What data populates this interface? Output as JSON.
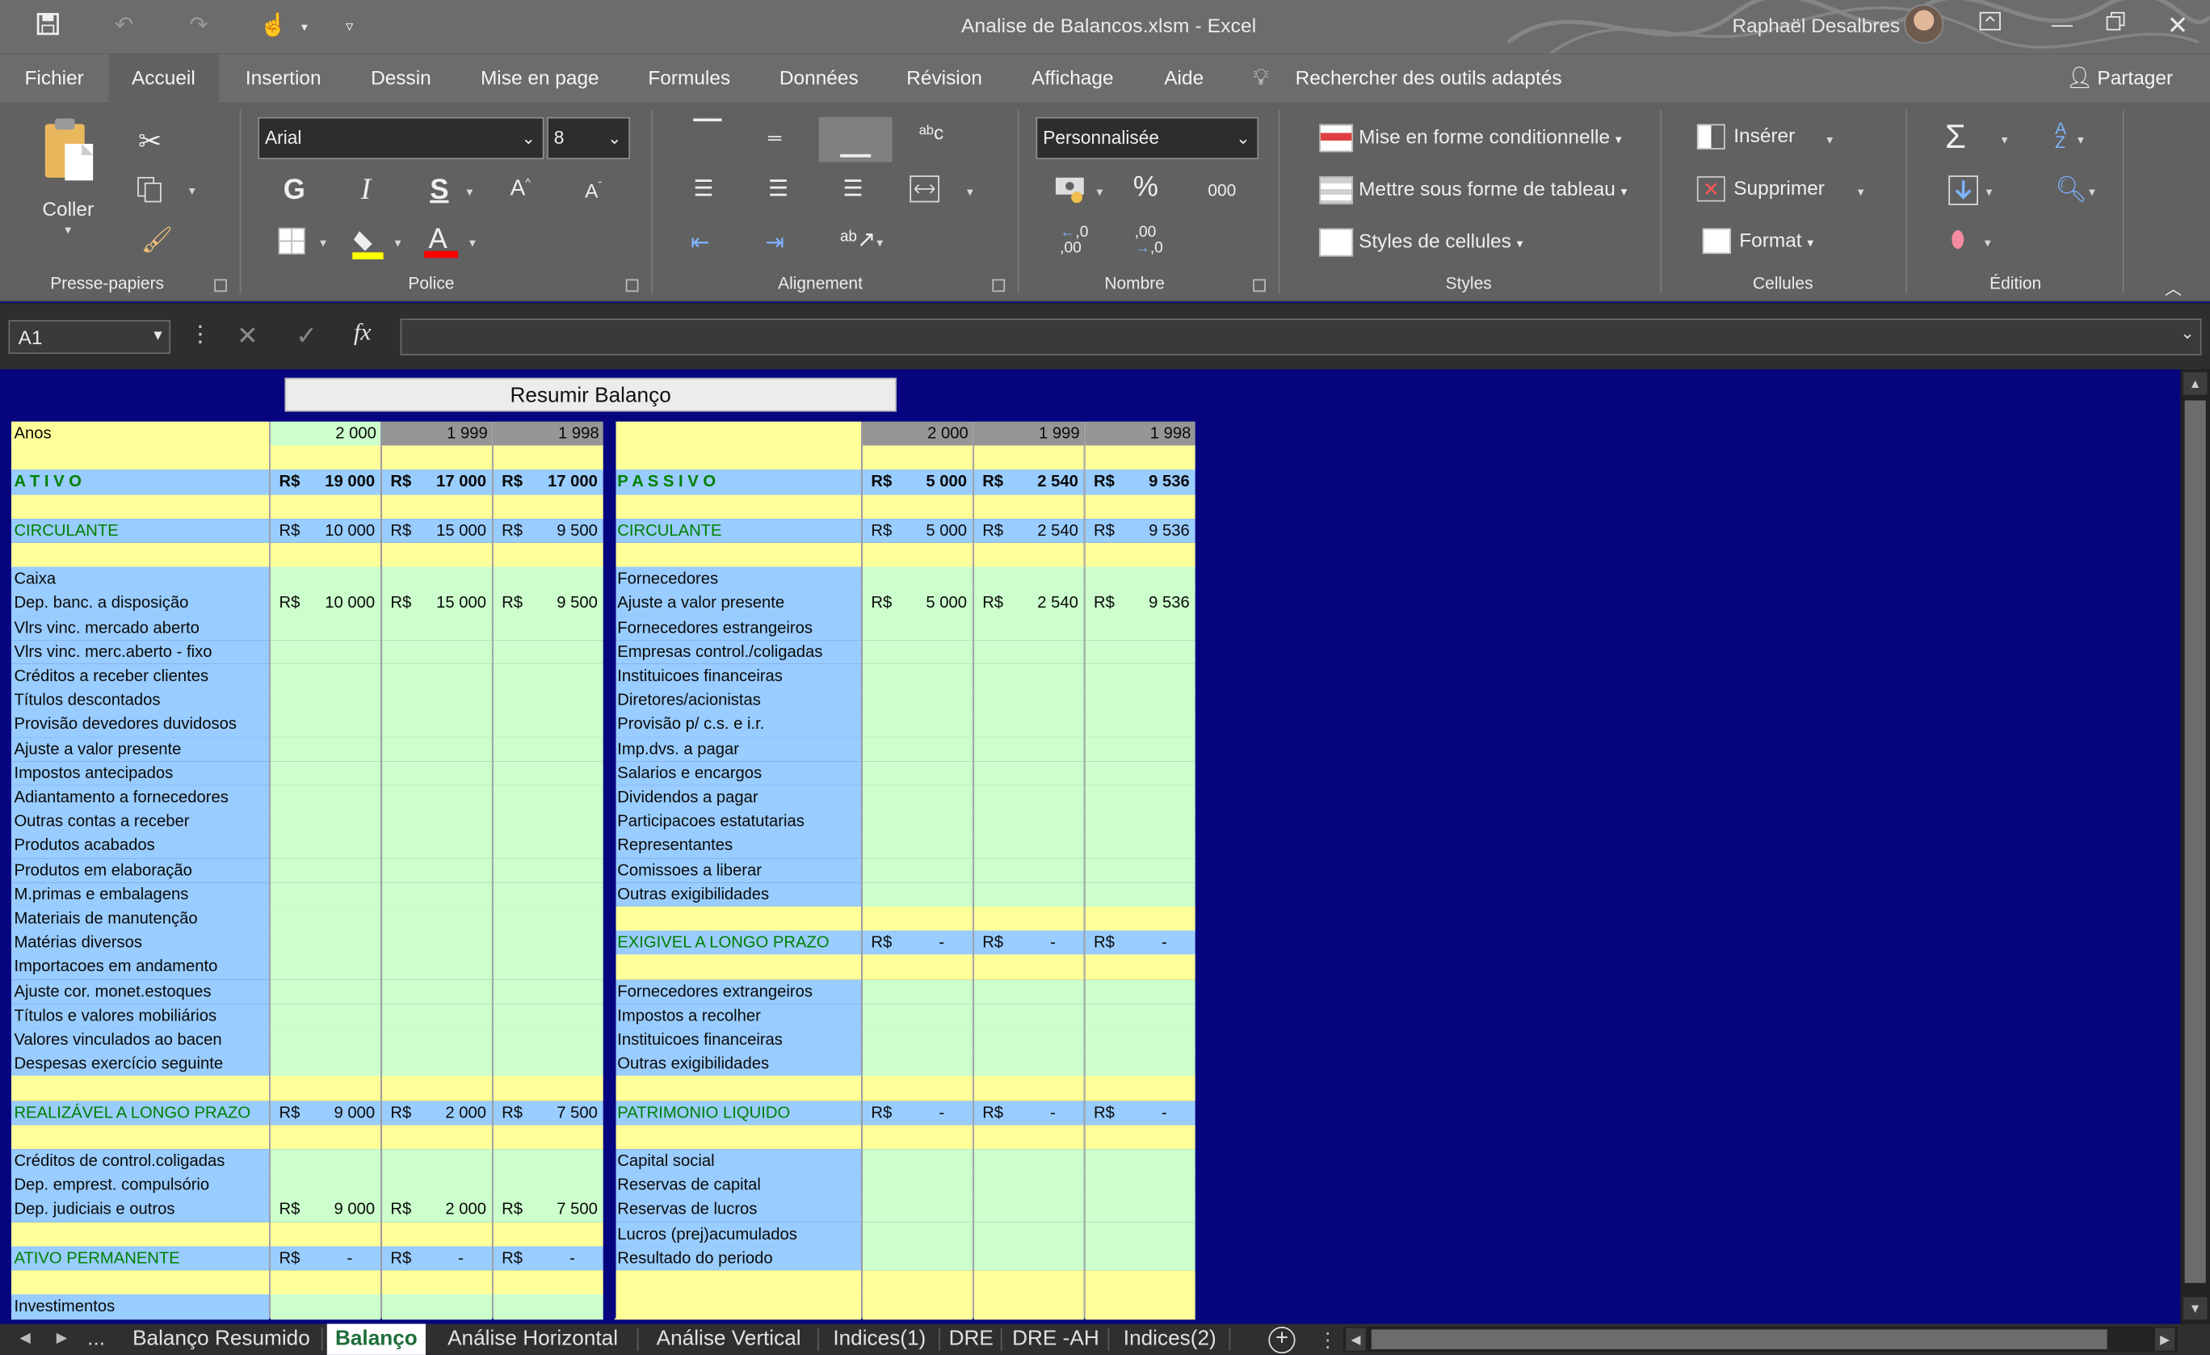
{
  "window": {
    "title": "Analise de Balancos.xlsm  -  Excel",
    "user": "Raphaël Desalbres"
  },
  "tabs": [
    "Fichier",
    "Accueil",
    "Insertion",
    "Dessin",
    "Mise en page",
    "Formules",
    "Données",
    "Révision",
    "Affichage",
    "Aide"
  ],
  "tellme": "Rechercher des outils adaptés",
  "share": "Partager",
  "ribbon": {
    "paste": "Coller",
    "groups": {
      "clipboard": "Presse-papiers",
      "font": "Police",
      "alignment": "Alignement",
      "number": "Nombre",
      "styles": "Styles",
      "cells": "Cellules",
      "editing": "Édition"
    },
    "font_name": "Arial",
    "font_size": "8",
    "number_format": "Personnalisée",
    "styles_buttons": [
      "Mise en forme conditionnelle",
      "Mettre sous forme de tableau",
      "Styles de cellules"
    ],
    "cells_buttons": [
      "Insérer",
      "Supprimer",
      "Format"
    ],
    "bold": "G",
    "italic": "I",
    "underline": "S",
    "percent": "%",
    "thousands": "000"
  },
  "formula_bar": {
    "name_box": "A1",
    "fx": "fx",
    "value": ""
  },
  "sheet": {
    "button": "Resumir Balanço",
    "years": [
      "2 000",
      "1 999",
      "1 998"
    ],
    "currency": "R$",
    "left_header": "Anos",
    "left": [
      {
        "label": "A T I V O",
        "style": "section",
        "values": [
          "19 000",
          "17 000",
          "17 000"
        ]
      },
      {
        "label": "CIRCULANTE",
        "style": "group",
        "values": [
          "10 000",
          "15 000",
          "9 500"
        ]
      },
      {
        "label": "Caixa"
      },
      {
        "label": "Dep. banc. a disposição",
        "values": [
          "10 000",
          "15 000",
          "9 500"
        ]
      },
      {
        "label": "Vlrs vinc. mercado aberto"
      },
      {
        "label": "Vlrs vinc. merc.aberto - fixo"
      },
      {
        "label": "Créditos a receber clientes"
      },
      {
        "label": "Títulos descontados"
      },
      {
        "label": "Provisão devedores duvidosos"
      },
      {
        "label": "Ajuste a valor presente"
      },
      {
        "label": "Impostos antecipados"
      },
      {
        "label": "Adiantamento a fornecedores"
      },
      {
        "label": "Outras contas a receber"
      },
      {
        "label": "Produtos acabados"
      },
      {
        "label": "Produtos em elaboração"
      },
      {
        "label": "M.primas e embalagens"
      },
      {
        "label": "Materiais de manutenção"
      },
      {
        "label": "Matérias diversos"
      },
      {
        "label": "Importacoes em andamento"
      },
      {
        "label": "Ajuste cor. monet.estoques"
      },
      {
        "label": "Títulos e valores mobiliários"
      },
      {
        "label": "Valores vinculados ao bacen"
      },
      {
        "label": "Despesas exercício seguinte"
      },
      {
        "label": " REALIZÁVEL A LONGO PRAZO",
        "style": "group",
        "values": [
          "9 000",
          "2 000",
          "7 500"
        ]
      },
      {
        "label": "Créditos de control.coligadas"
      },
      {
        "label": "Dep. emprest. compulsório"
      },
      {
        "label": "Dep. judiciais e outros",
        "values": [
          "9 000",
          "2 000",
          "7 500"
        ]
      },
      {
        "label": "ATIVO PERMANENTE",
        "style": "group",
        "values": [
          "-",
          "-",
          "-"
        ]
      },
      {
        "label": "Investimentos"
      }
    ],
    "right": [
      {
        "label": "P A S S I V O",
        "style": "section",
        "values": [
          "5 000",
          "2 540",
          "9 536"
        ]
      },
      {
        "label": "CIRCULANTE",
        "style": "group",
        "values": [
          "5 000",
          "2 540",
          "9 536"
        ]
      },
      {
        "label": "Fornecedores"
      },
      {
        "label": "Ajuste a valor presente",
        "values": [
          "5 000",
          "2 540",
          "9 536"
        ]
      },
      {
        "label": "Fornecedores estrangeiros"
      },
      {
        "label": "Empresas control./coligadas"
      },
      {
        "label": "Instituicoes financeiras"
      },
      {
        "label": "Diretores/acionistas"
      },
      {
        "label": "Provisão p/ c.s. e i.r."
      },
      {
        "label": "Imp.dvs. a pagar"
      },
      {
        "label": "Salarios e encargos"
      },
      {
        "label": "Dividendos a pagar"
      },
      {
        "label": "Participacoes estatutarias"
      },
      {
        "label": "Representantes"
      },
      {
        "label": "Comissoes a liberar"
      },
      {
        "label": "Outras exigibilidades"
      },
      {
        "label": "EXIGIVEL A LONGO PRAZO",
        "style": "group",
        "values": [
          "-",
          "-",
          "-"
        ]
      },
      {
        "label": "Fornecedores extrangeiros"
      },
      {
        "label": "Impostos a recolher"
      },
      {
        "label": "Instituicoes financeiras"
      },
      {
        "label": "Outras exigibilidades"
      },
      {
        "label": "PATRIMONIO LIQUIDO",
        "style": "group",
        "values": [
          "-",
          "-",
          "-"
        ]
      },
      {
        "label": "Capital social"
      },
      {
        "label": "Reservas de capital"
      },
      {
        "label": "Reservas de lucros"
      },
      {
        "label": "Lucros (prej)acumulados"
      },
      {
        "label": "Resultado do periodo"
      }
    ]
  },
  "sheet_tabs": [
    "Balanço Resumido",
    "Balanço",
    "Análise Horizontal",
    "Análise Vertical",
    "Indices(1)",
    "DRE",
    "DRE -AH",
    "Indices(2)"
  ],
  "active_sheet": "Balanço",
  "ellipsis": "...",
  "colors": {
    "sheet_bg": "#06057f",
    "yellow": "#ffff99",
    "blue": "#99ccff",
    "green": "#ccffcc",
    "label_green": "#008000",
    "ribbon": "#616161"
  }
}
